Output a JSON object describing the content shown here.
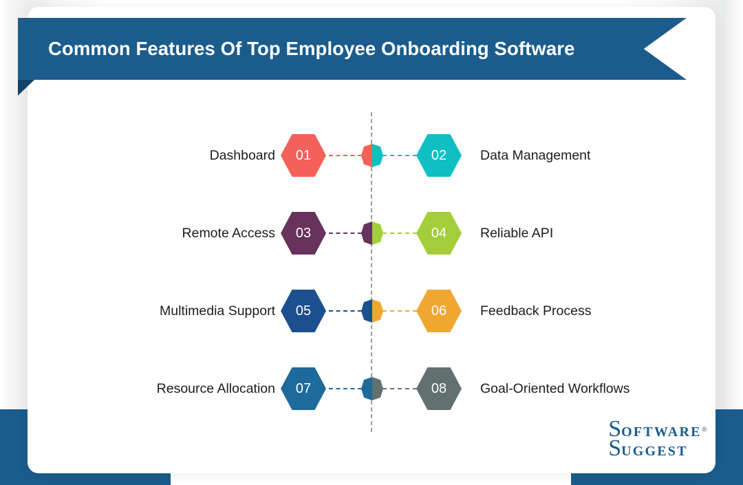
{
  "banner": {
    "title": "Common Features Of Top Employee Onboarding Software",
    "background_color": "#1b5c8c",
    "fold_color": "#12446a",
    "text_color": "#ffffff"
  },
  "theme": {
    "card_background": "#ffffff",
    "page_background": "#ffffff",
    "corner_block_color": "#1b5c8c",
    "center_line_color": "#9c9c9c",
    "label_text_color": "#1c1c1c"
  },
  "rows": [
    {
      "left": {
        "number": "01",
        "label": "Dashboard",
        "color": "#f4605a"
      },
      "right": {
        "number": "02",
        "label": "Data Management",
        "color": "#0fbfc4"
      }
    },
    {
      "left": {
        "number": "03",
        "label": "Remote Access",
        "color": "#67325c"
      },
      "right": {
        "number": "04",
        "label": "Reliable API",
        "color": "#a3ce39"
      }
    },
    {
      "left": {
        "number": "05",
        "label": "Multimedia Support",
        "color": "#1b4f8f"
      },
      "right": {
        "number": "06",
        "label": "Feedback Process",
        "color": "#f0a732"
      }
    },
    {
      "left": {
        "number": "07",
        "label": "Resource Allocation",
        "color": "#1d6a9b"
      },
      "right": {
        "number": "08",
        "label": "Goal-Oriented Workflows",
        "color": "#62706f"
      }
    }
  ],
  "logo": {
    "line1_cap": "S",
    "line1_rest": "oftware",
    "registered": "®",
    "line2_cap": "S",
    "line2_rest": "uggest",
    "color": "#1b5c8c"
  }
}
